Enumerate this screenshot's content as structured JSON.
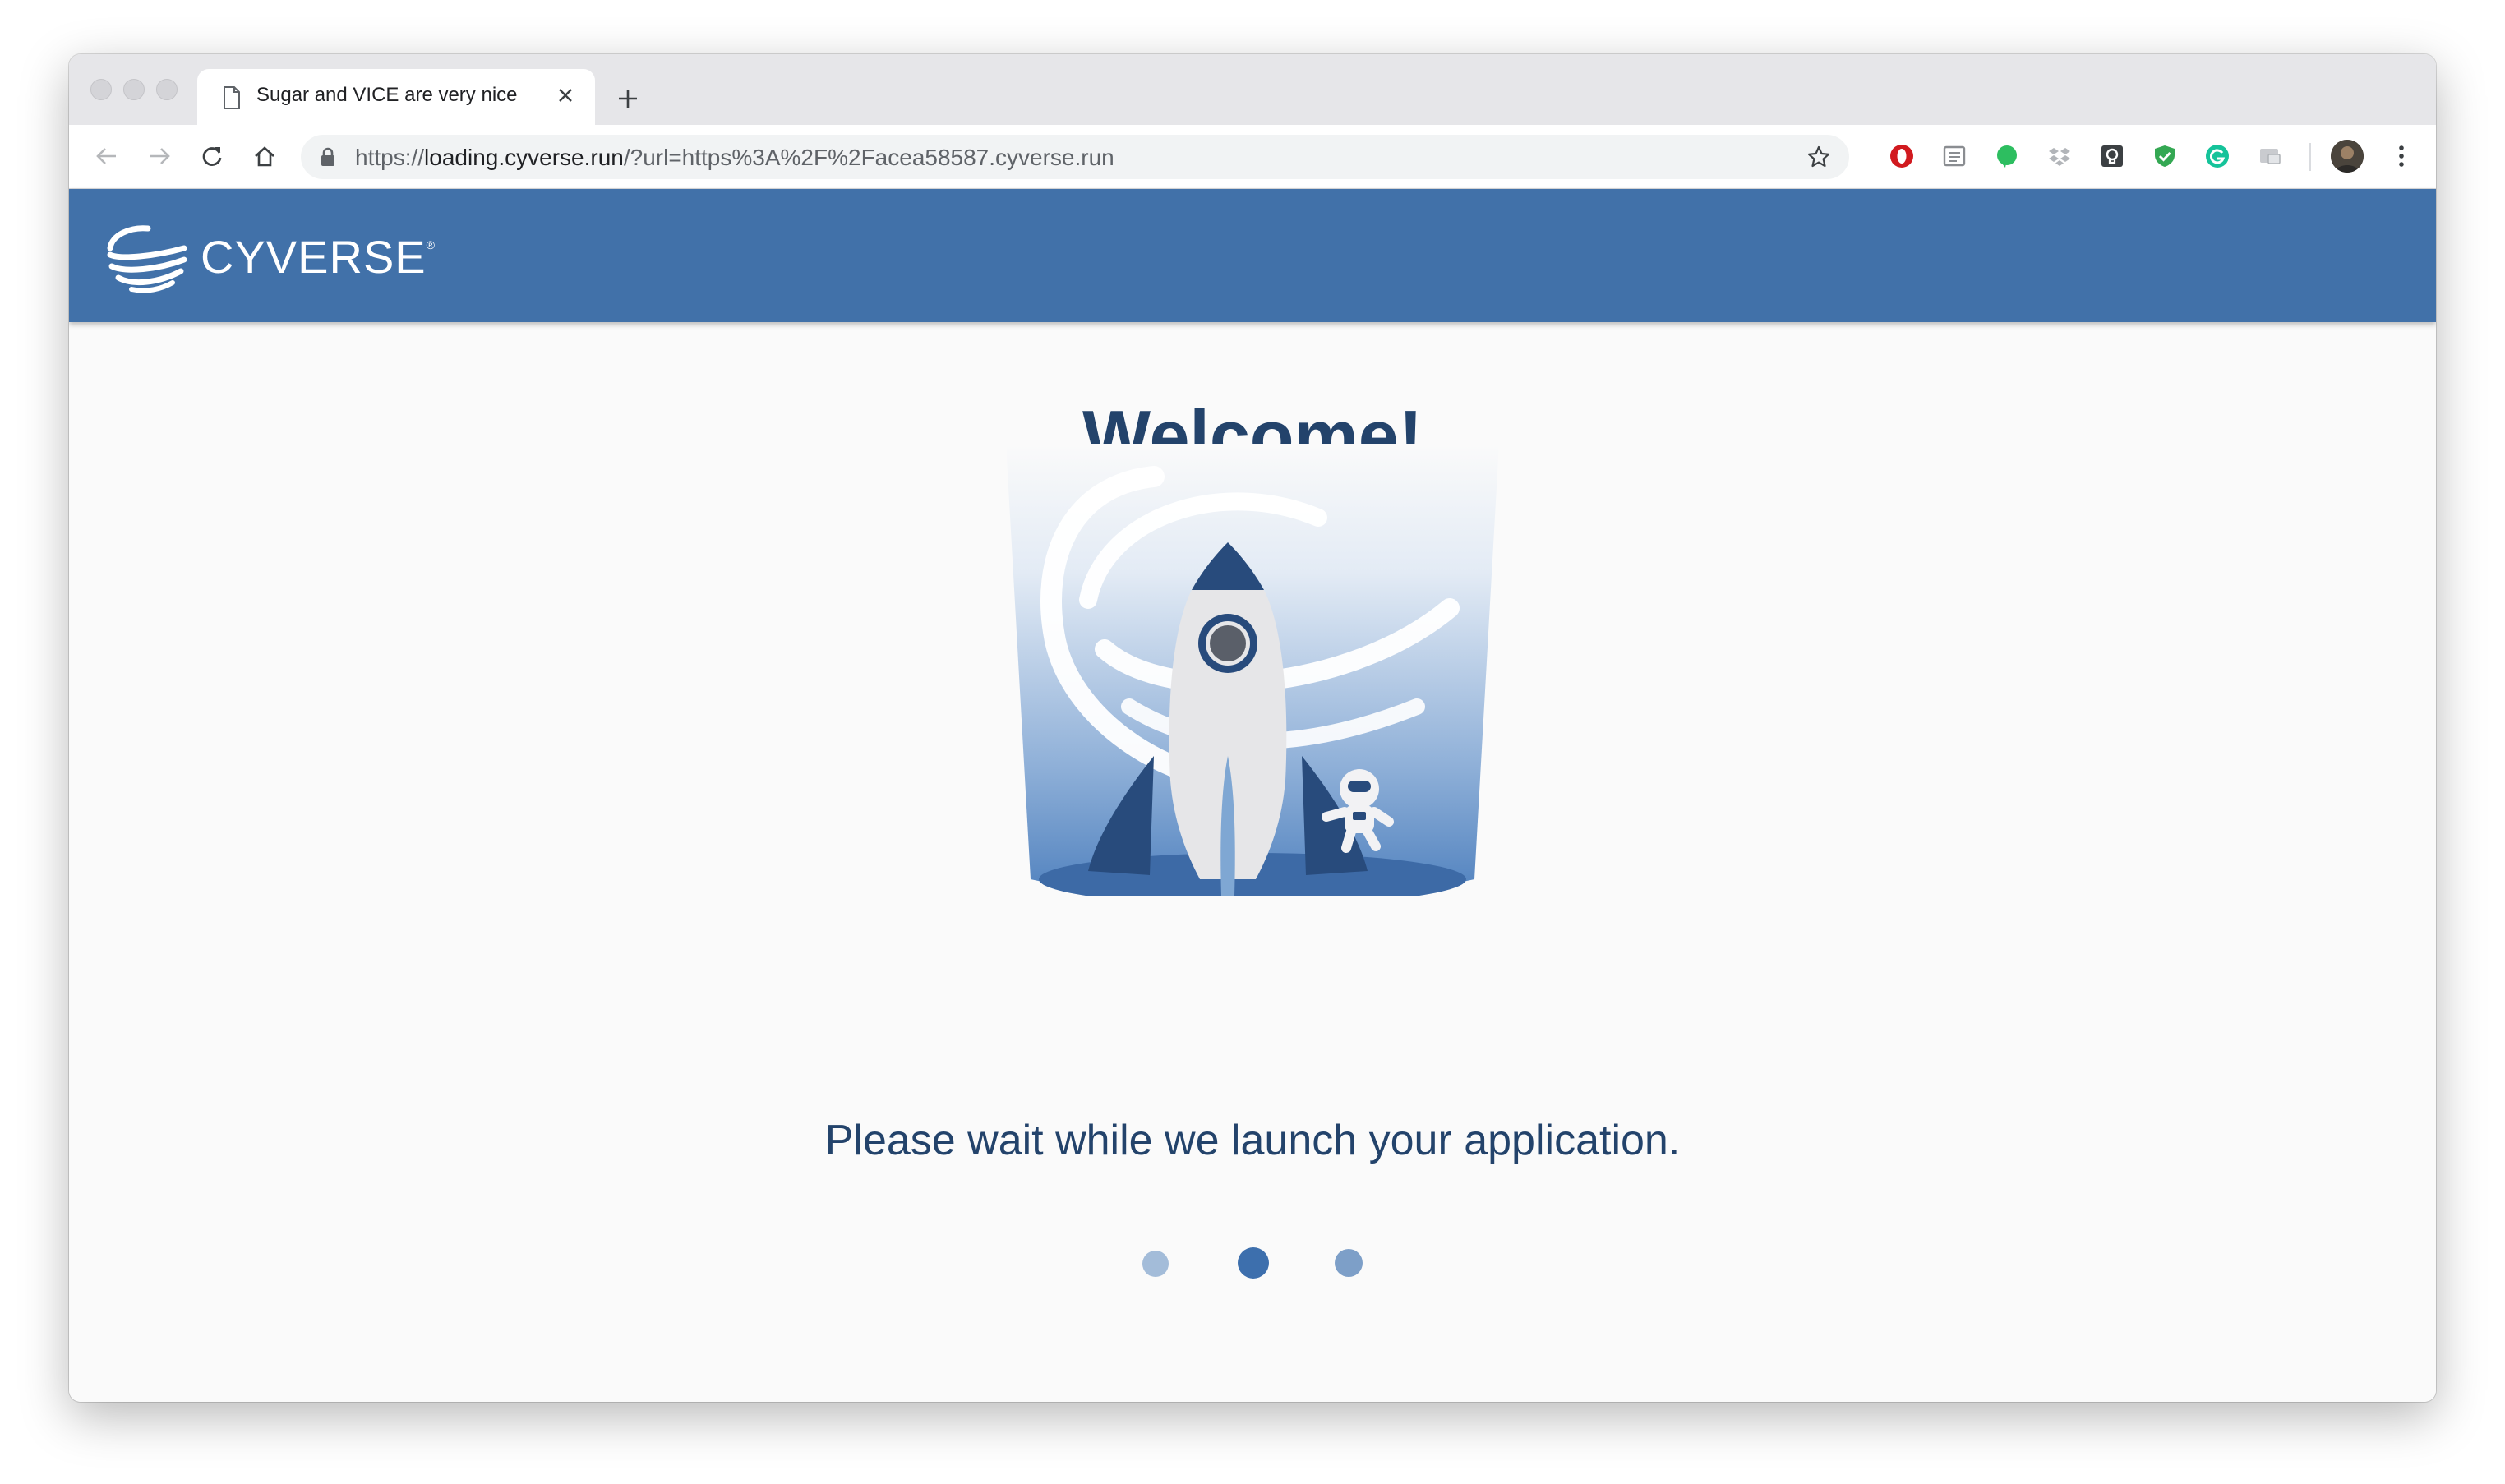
{
  "browser": {
    "tab_title": "Sugar and VICE are very nice",
    "url_scheme": "https://",
    "url_host": "loading.cyverse.run",
    "url_path": "/?url=https%3A%2F%2Facea58587.cyverse.run",
    "icons": {
      "back": "arrow-left-icon",
      "forward": "arrow-right-icon",
      "reload": "reload-icon",
      "home": "home-icon",
      "bookmark": "star-icon",
      "menu": "more-vert-icon"
    },
    "extensions": [
      "opera-extension-icon",
      "reader-extension-icon",
      "evernote-extension-icon",
      "dropbox-extension-icon",
      "keep-extension-icon",
      "shield-extension-icon",
      "grammarly-extension-icon",
      "cast-extension-icon"
    ]
  },
  "site": {
    "brand": "CYVERSE",
    "brand_mark": "®",
    "header_color": "#4171a9"
  },
  "main": {
    "heading": "Welcome!",
    "message": "Please wait while we launch your application.",
    "loading_dots": 3,
    "active_dot": 2
  },
  "colors": {
    "accent": "#23436b",
    "dot_active": "#3d6fad",
    "dot_light": "#a3bcd9",
    "dot_mid": "#7d9fc8"
  }
}
